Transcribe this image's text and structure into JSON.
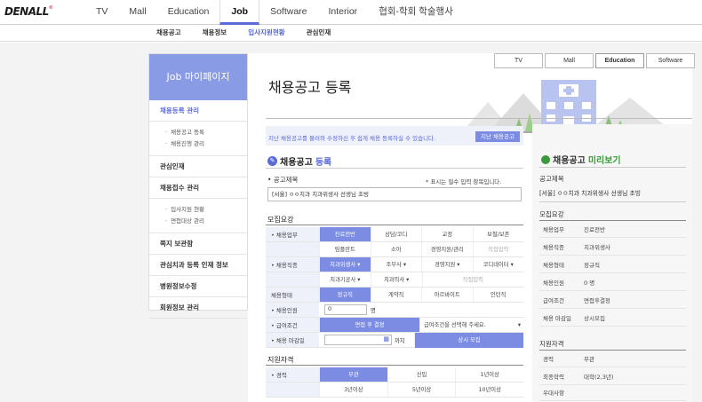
{
  "logo": {
    "main": "DENALL",
    "mark": "®"
  },
  "nav": {
    "items": [
      "TV",
      "Mall",
      "Education",
      "Job",
      "Software",
      "Interior",
      "협회-학회 학술행사"
    ],
    "active": "Job"
  },
  "subnav": {
    "items": [
      "채용공고",
      "채용정보",
      "입사지원현황",
      "관심인재"
    ],
    "active": "입사지원현황"
  },
  "sidebar": {
    "title": "Job 마이페이지",
    "sections": [
      {
        "label": "채용등록 관리",
        "subs": [
          "채용공고 등록",
          "채용진행 관리"
        ]
      },
      {
        "label": "관심인재",
        "subs": []
      },
      {
        "label": "채용접수 관리",
        "subs": [
          "입사지원 현황",
          "면접대상 관리"
        ]
      },
      {
        "label": "쪽지 보관함",
        "subs": []
      },
      {
        "label": "관심치과 등록 인재 정보",
        "subs": []
      },
      {
        "label": "병원정보수정",
        "subs": []
      },
      {
        "label": "회원정보 관리",
        "subs": []
      }
    ]
  },
  "tabs": [
    "TV",
    "Mall",
    "Education",
    "Software"
  ],
  "page_title": "채용공고 등록",
  "notice": {
    "text": "지난 채용공고를 불러와 수정하신 후 쉽게 채용 등록하실 수 있습니다.",
    "button": "지난 채용공고"
  },
  "form": {
    "section_title_1": "채용공고",
    "section_title_2": "등록",
    "title_label": "• 공고제목",
    "required_note": "* 표시는 필수 입력 항목입니다.",
    "title_value": "[서울] ㅇㅇ치과 치과위생사 선생님 초빙",
    "recruit_label": "모집요강",
    "rows": [
      {
        "label": "• 채용업무",
        "cells": [
          "진료전반",
          "상담/코디",
          "교정",
          "보철/보존"
        ]
      },
      {
        "label": "",
        "cells": [
          "임플란트",
          "소아",
          "경영지원/관리",
          "직접입력"
        ]
      },
      {
        "label": "• 채용직종",
        "cells": [
          "치과위생사 ▾",
          "조무사 ▾",
          "경영지원 ▾",
          "코디네이터 ▾"
        ]
      },
      {
        "label": "",
        "cells": [
          "치과기공사 ▾",
          "치과의사 ▾",
          "직접입력",
          ""
        ]
      },
      {
        "label": "채용형태",
        "cells": [
          "정규직",
          "계약직",
          "아르바이트",
          "인턴직"
        ]
      },
      {
        "label": "• 채용인원",
        "cells": [
          "0",
          "명",
          "",
          ""
        ]
      },
      {
        "label": "• 급여조건",
        "cells": [
          "면접 후 결정",
          "급여조건을 선택해 주세요.",
          ""
        ]
      },
      {
        "label": "• 채용 마감일",
        "cells": [
          "",
          "까지",
          "상시 모집"
        ]
      }
    ],
    "qual_label": "지원자격",
    "qual_rows": [
      {
        "label": "• 경력",
        "cells": [
          "무관",
          "신입",
          "1년이상"
        ]
      },
      {
        "label": "",
        "cells": [
          "3년이상",
          "5년이상",
          "10년이상"
        ]
      }
    ]
  },
  "preview": {
    "title_1": "채용공고",
    "title_2": "미리보기",
    "notice_label": "공고제목",
    "notice_value": "[서울] ㅇㅇ치과 치과위생사 선생님 초빙",
    "recruit_label": "모집요강",
    "rows": [
      {
        "k": "채용업무",
        "v": "진료전반"
      },
      {
        "k": "채용직종",
        "v": "치과위생사"
      },
      {
        "k": "채용형태",
        "v": "정규직"
      },
      {
        "k": "채용인원",
        "v": "0 명"
      },
      {
        "k": "급여조건",
        "v": "면접후결정"
      },
      {
        "k": "채용 마감일",
        "v": "상시모집"
      }
    ],
    "qual_label": "지원자격",
    "qual_rows": [
      {
        "k": "경력",
        "v": "무관"
      },
      {
        "k": "최종학력",
        "v": "대학(2,3년)"
      },
      {
        "k": "우대사항",
        "v": ""
      }
    ]
  },
  "colors": {
    "accent": "#5a6ad8",
    "sidebar_head": "#8a9be6",
    "preview_green": "#3a9a3a"
  }
}
